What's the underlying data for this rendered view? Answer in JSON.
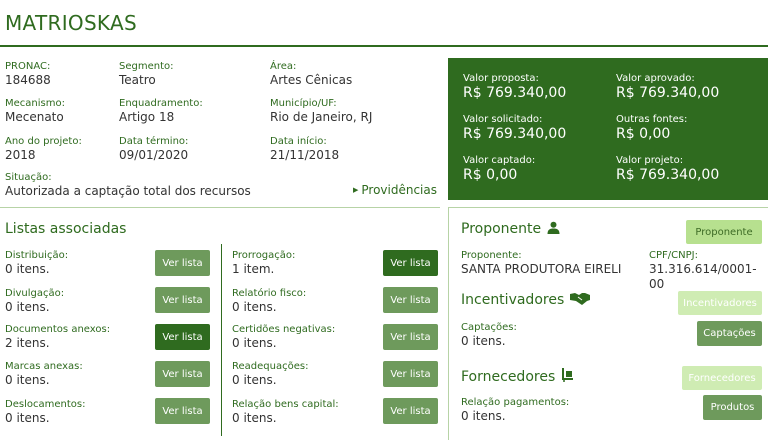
{
  "page": {
    "title": "MATRIOSKAS"
  },
  "project_info": {
    "pronac": {
      "label": "PRONAC:",
      "value": "184688"
    },
    "segmento": {
      "label": "Segmento:",
      "value": "Teatro"
    },
    "area": {
      "label": "Área:",
      "value": "Artes Cênicas"
    },
    "mecanismo": {
      "label": "Mecanismo:",
      "value": "Mecenato"
    },
    "enquadramento": {
      "label": "Enquadramento:",
      "value": "Artigo 18"
    },
    "municipio": {
      "label": "Município/UF:",
      "value": "Rio de Janeiro, RJ"
    },
    "ano": {
      "label": "Ano do projeto:",
      "value": "2018"
    },
    "data_termino": {
      "label": "Data término:",
      "value": "09/01/2020"
    },
    "data_inicio": {
      "label": "Data início:",
      "value": "21/11/2018"
    },
    "situacao": {
      "label": "Situação:",
      "value": "Autorizada a captação total dos recursos"
    },
    "providencias_link": "Providências"
  },
  "values": {
    "valor_proposta": {
      "label": "Valor proposta:",
      "value": "R$ 769.340,00"
    },
    "valor_aprovado": {
      "label": "Valor aprovado:",
      "value": "R$ 769.340,00"
    },
    "valor_solicitado": {
      "label": "Valor solicitado:",
      "value": "R$ 769.340,00"
    },
    "outras_fontes": {
      "label": "Outras fontes:",
      "value": "R$ 0,00"
    },
    "valor_captado": {
      "label": "Valor captado:",
      "value": "R$ 0,00"
    },
    "valor_projeto": {
      "label": "Valor projeto:",
      "value": "R$ 769.340,00"
    }
  },
  "listas": {
    "title": "Listas associadas",
    "button_label": "Ver lista",
    "left": [
      {
        "label": "Distribuição:",
        "value": "0 itens."
      },
      {
        "label": "Divulgação:",
        "value": "0 itens."
      },
      {
        "label": "Documentos anexos:",
        "value": "2 itens."
      },
      {
        "label": "Marcas anexas:",
        "value": "0 itens."
      },
      {
        "label": "Deslocamentos:",
        "value": "0 itens."
      }
    ],
    "right": [
      {
        "label": "Prorrogação:",
        "value": "1 item."
      },
      {
        "label": "Relatório fisco:",
        "value": "0 itens."
      },
      {
        "label": "Certidões negativas:",
        "value": "0 itens."
      },
      {
        "label": "Readequações:",
        "value": "0 itens."
      },
      {
        "label": "Relação bens capital:",
        "value": "0 itens."
      }
    ]
  },
  "proponente": {
    "title": "Proponente",
    "button": "Proponente",
    "proponente_label": "Proponente:",
    "proponente_value": "SANTA PRODUTORA EIRELI",
    "cpf_label": "CPF/CNPJ:",
    "cpf_value": "31.316.614/0001-00"
  },
  "incentivadores": {
    "title": "Incentivadores",
    "button": "Incentivadores",
    "captacoes_label": "Captações:",
    "captacoes_value": "0 itens.",
    "captacoes_button": "Captações"
  },
  "fornecedores": {
    "title": "Fornecedores",
    "button": "Fornecedores",
    "relacao_label": "Relação pagamentos:",
    "relacao_value": "0 itens.",
    "produtos_button": "Produtos"
  },
  "colors": {
    "primary": "#2f6b1f",
    "button": "#6e9a5c",
    "pale": "#b7e08f"
  }
}
